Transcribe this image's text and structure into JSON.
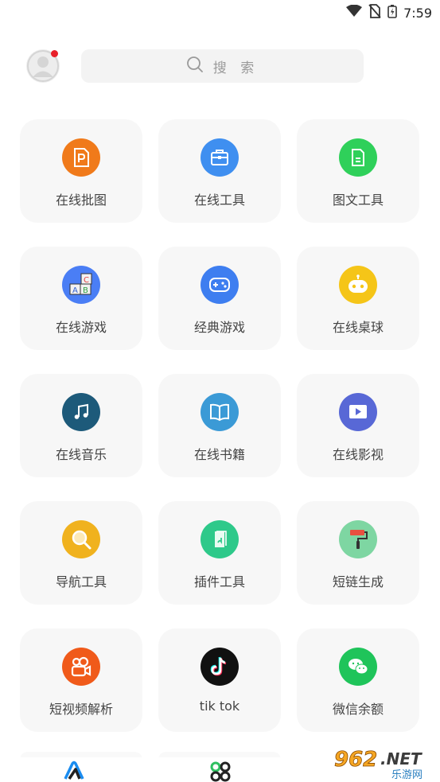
{
  "status_bar": {
    "time": "7:59"
  },
  "header": {
    "search_placeholder": "搜 索"
  },
  "tiles": [
    {
      "label": "在线批图",
      "color": "#f07a1a",
      "icon": "ppt-file-icon"
    },
    {
      "label": "在线工具",
      "color": "#3f8ff0",
      "icon": "briefcase-icon"
    },
    {
      "label": "图文工具",
      "color": "#2fd05a",
      "icon": "document-icon"
    },
    {
      "label": "在线游戏",
      "color": "#4a7ef5",
      "icon": "abc-blocks-icon"
    },
    {
      "label": "经典游戏",
      "color": "#3e7ef0",
      "icon": "gamepad-icon"
    },
    {
      "label": "在线桌球",
      "color": "#f5c518",
      "icon": "robot-face-icon"
    },
    {
      "label": "在线音乐",
      "color": "#1d5a7a",
      "icon": "music-note-icon"
    },
    {
      "label": "在线书籍",
      "color": "#3b9ad6",
      "icon": "open-book-icon"
    },
    {
      "label": "在线影视",
      "color": "#5868d6",
      "icon": "video-play-icon"
    },
    {
      "label": "导航工具",
      "color": "#f0b21e",
      "icon": "magnifier-icon"
    },
    {
      "label": "插件工具",
      "color": "#2ec98a",
      "icon": "plugin-icon"
    },
    {
      "label": "短链生成",
      "color": "#7ed6a2",
      "icon": "paint-roller-icon"
    },
    {
      "label": "短视频解析",
      "color": "#f05a1a",
      "icon": "kuaishou-camera-icon"
    },
    {
      "label": "tik tok",
      "color": "#111111",
      "icon": "tiktok-icon"
    },
    {
      "label": "微信余额",
      "color": "#1fc45a",
      "icon": "wechat-icon"
    }
  ],
  "watermark": {
    "brand": "962.NET",
    "subtitle": "乐游网"
  },
  "colors": {
    "accent": "#1a8cf0",
    "badge": "#e8202a",
    "tile_bg": "#f7f7f7"
  }
}
